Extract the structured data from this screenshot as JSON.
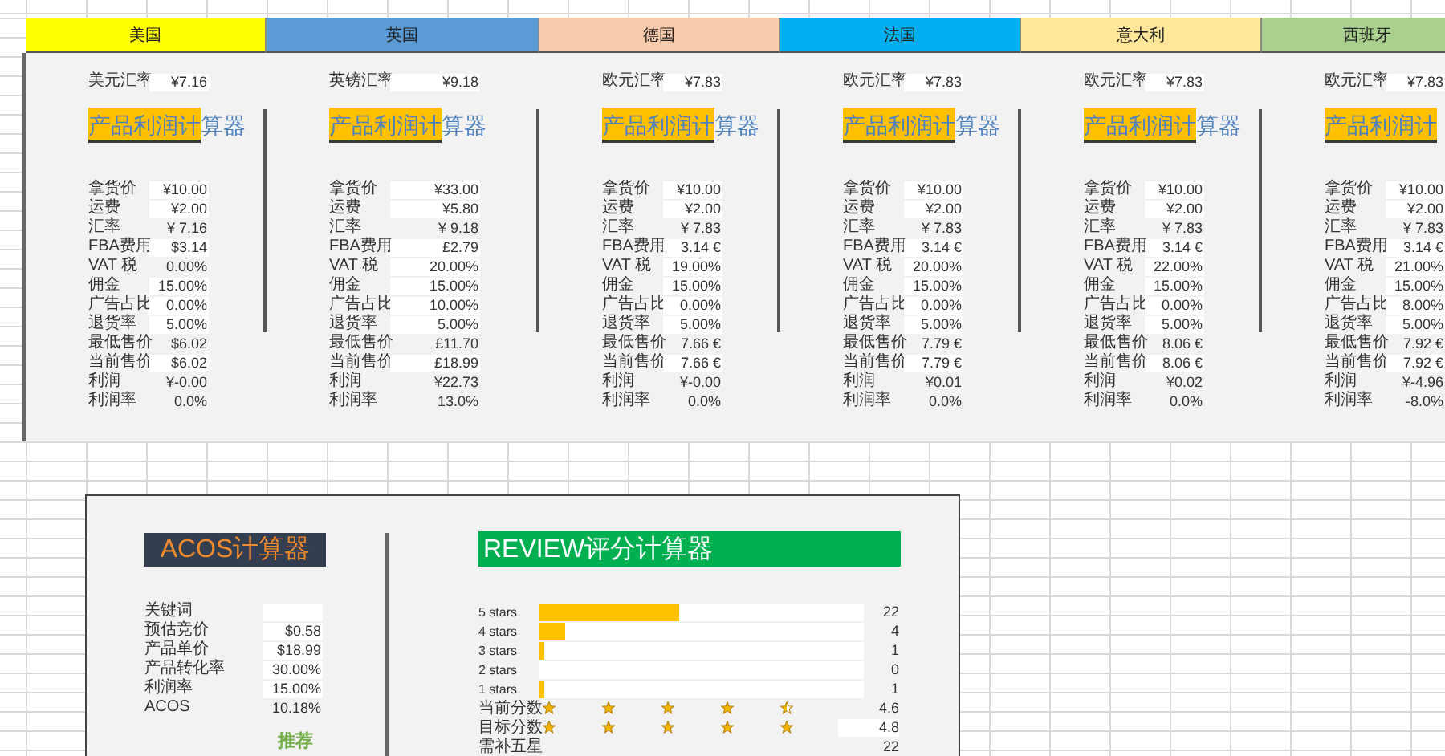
{
  "countries": [
    {
      "name": "美国",
      "color": "#ffff00",
      "rate_label": "美元汇率",
      "rate_value": "¥7.16",
      "title": "产品利润计算器",
      "rows": [
        {
          "label": "拿货价",
          "value": "¥10.00",
          "kind": "input"
        },
        {
          "label": "运费",
          "value": "¥2.00",
          "kind": "input"
        },
        {
          "label": "汇率",
          "value": "¥ 7.16",
          "kind": "plain"
        },
        {
          "label": "FBA费用",
          "value": "$3.14",
          "kind": "input"
        },
        {
          "label": "VAT 税",
          "value": "0.00%",
          "kind": "plain"
        },
        {
          "label": "佣金",
          "value": "15.00%",
          "kind": "input"
        },
        {
          "label": "广告占比",
          "value": "0.00%",
          "kind": "input"
        },
        {
          "label": "退货率",
          "value": "5.00%",
          "kind": "input"
        },
        {
          "label": "最低售价",
          "value": "$6.02",
          "kind": "plain"
        },
        {
          "label": "当前售价",
          "value": "$6.02",
          "kind": "input"
        },
        {
          "label": "利润",
          "value": "¥-0.00",
          "kind": "plain"
        },
        {
          "label": "利润率",
          "value": "0.0%",
          "kind": "plain"
        }
      ]
    },
    {
      "name": "英国",
      "color": "#5b9bd5",
      "rate_label": "英镑汇率",
      "rate_value": "¥9.18",
      "title": "产品利润计算器",
      "rows": [
        {
          "label": "拿货价",
          "value": "¥33.00",
          "kind": "input"
        },
        {
          "label": "运费",
          "value": "¥5.80",
          "kind": "input"
        },
        {
          "label": "汇率",
          "value": "¥ 9.18",
          "kind": "plain"
        },
        {
          "label": "FBA费用",
          "value": "£2.79",
          "kind": "input"
        },
        {
          "label": "VAT 税",
          "value": "20.00%",
          "kind": "input"
        },
        {
          "label": "佣金",
          "value": "15.00%",
          "kind": "input"
        },
        {
          "label": "广告占比",
          "value": "10.00%",
          "kind": "input"
        },
        {
          "label": "退货率",
          "value": "5.00%",
          "kind": "input"
        },
        {
          "label": "最低售价",
          "value": "£11.70",
          "kind": "plain"
        },
        {
          "label": "当前售价",
          "value": "£18.99",
          "kind": "input"
        },
        {
          "label": "利润",
          "value": "¥22.73",
          "kind": "plain"
        },
        {
          "label": "利润率",
          "value": "13.0%",
          "kind": "plain"
        }
      ]
    },
    {
      "name": "德国",
      "color": "#f8cbad",
      "rate_label": "欧元汇率",
      "rate_value": "¥7.83",
      "title": "产品利润计算器",
      "rows": [
        {
          "label": "拿货价",
          "value": "¥10.00",
          "kind": "input"
        },
        {
          "label": "运费",
          "value": "¥2.00",
          "kind": "input"
        },
        {
          "label": "汇率",
          "value": "¥ 7.83",
          "kind": "plain"
        },
        {
          "label": "FBA费用",
          "value": "3.14 €",
          "kind": "input"
        },
        {
          "label": "VAT 税",
          "value": "19.00%",
          "kind": "input"
        },
        {
          "label": "佣金",
          "value": "15.00%",
          "kind": "input"
        },
        {
          "label": "广告占比",
          "value": "0.00%",
          "kind": "input"
        },
        {
          "label": "退货率",
          "value": "5.00%",
          "kind": "input"
        },
        {
          "label": "最低售价",
          "value": "7.66 €",
          "kind": "plain"
        },
        {
          "label": "当前售价",
          "value": "7.66 €",
          "kind": "input"
        },
        {
          "label": "利润",
          "value": "¥-0.00",
          "kind": "plain"
        },
        {
          "label": "利润率",
          "value": "0.0%",
          "kind": "plain"
        }
      ]
    },
    {
      "name": "法国",
      "color": "#00b0f0",
      "rate_label": "欧元汇率",
      "rate_value": "¥7.83",
      "title": "产品利润计算器",
      "rows": [
        {
          "label": "拿货价",
          "value": "¥10.00",
          "kind": "input"
        },
        {
          "label": "运费",
          "value": "¥2.00",
          "kind": "input"
        },
        {
          "label": "汇率",
          "value": "¥ 7.83",
          "kind": "plain"
        },
        {
          "label": "FBA费用",
          "value": "3.14 €",
          "kind": "input"
        },
        {
          "label": "VAT 税",
          "value": "20.00%",
          "kind": "input"
        },
        {
          "label": "佣金",
          "value": "15.00%",
          "kind": "input"
        },
        {
          "label": "广告占比",
          "value": "0.00%",
          "kind": "input"
        },
        {
          "label": "退货率",
          "value": "5.00%",
          "kind": "input"
        },
        {
          "label": "最低售价",
          "value": "7.79 €",
          "kind": "plain"
        },
        {
          "label": "当前售价",
          "value": "7.79 €",
          "kind": "input"
        },
        {
          "label": "利润",
          "value": "¥0.01",
          "kind": "plain"
        },
        {
          "label": "利润率",
          "value": "0.0%",
          "kind": "plain"
        }
      ]
    },
    {
      "name": "意大利",
      "color": "#ffe699",
      "rate_label": "欧元汇率",
      "rate_value": "¥7.83",
      "title": "产品利润计算器",
      "rows": [
        {
          "label": "拿货价",
          "value": "¥10.00",
          "kind": "input"
        },
        {
          "label": "运费",
          "value": "¥2.00",
          "kind": "input"
        },
        {
          "label": "汇率",
          "value": "¥ 7.83",
          "kind": "plain"
        },
        {
          "label": "FBA费用",
          "value": "3.14 €",
          "kind": "input"
        },
        {
          "label": "VAT 税",
          "value": "22.00%",
          "kind": "input"
        },
        {
          "label": "佣金",
          "value": "15.00%",
          "kind": "input"
        },
        {
          "label": "广告占比",
          "value": "0.00%",
          "kind": "input"
        },
        {
          "label": "退货率",
          "value": "5.00%",
          "kind": "input"
        },
        {
          "label": "最低售价",
          "value": "8.06 €",
          "kind": "plain"
        },
        {
          "label": "当前售价",
          "value": "8.06 €",
          "kind": "input"
        },
        {
          "label": "利润",
          "value": "¥0.02",
          "kind": "plain"
        },
        {
          "label": "利润率",
          "value": "0.0%",
          "kind": "plain"
        }
      ]
    },
    {
      "name": "西班牙",
      "color": "#a9d08e",
      "rate_label": "欧元汇率",
      "rate_value": "¥7.83",
      "title": "产品利润计",
      "rows": [
        {
          "label": "拿货价",
          "value": "¥10.00",
          "kind": "input"
        },
        {
          "label": "运费",
          "value": "¥2.00",
          "kind": "input"
        },
        {
          "label": "汇率",
          "value": "¥ 7.83",
          "kind": "plain"
        },
        {
          "label": "FBA费用",
          "value": "3.14 €",
          "kind": "input"
        },
        {
          "label": "VAT 税",
          "value": "21.00%",
          "kind": "input"
        },
        {
          "label": "佣金",
          "value": "15.00%",
          "kind": "input"
        },
        {
          "label": "广告占比",
          "value": "8.00%",
          "kind": "input"
        },
        {
          "label": "退货率",
          "value": "5.00%",
          "kind": "input"
        },
        {
          "label": "最低售价",
          "value": "7.92 €",
          "kind": "plain"
        },
        {
          "label": "当前售价",
          "value": "7.92 €",
          "kind": "input"
        },
        {
          "label": "利润",
          "value": "¥-4.96",
          "kind": "plain"
        },
        {
          "label": "利润率",
          "value": "-8.0%",
          "kind": "plain"
        }
      ]
    }
  ],
  "acos": {
    "title": "ACOS计算器",
    "rows": [
      {
        "label": "关键词",
        "kind": "input"
      },
      {
        "label": "预估竞价",
        "value": "$0.58",
        "kind": "input"
      },
      {
        "label": "产品单价",
        "value": "$18.99",
        "kind": "input"
      },
      {
        "label": "产品转化率",
        "value": "30.00%",
        "kind": "input"
      },
      {
        "label": "利润率",
        "value": "15.00%",
        "kind": "input"
      },
      {
        "label": "ACOS",
        "value": "10.18%",
        "kind": "plain"
      }
    ],
    "recommend": "推荐"
  },
  "review": {
    "title": "REVIEW评分计算器",
    "bars": [
      {
        "label": "5 stars",
        "level": 0.43,
        "count": "22"
      },
      {
        "label": "4 stars",
        "level": 0.08,
        "count": "4"
      },
      {
        "label": "3 stars",
        "level": 0.016,
        "count": "1"
      },
      {
        "label": "2 stars",
        "count": "0"
      },
      {
        "label": "1 stars",
        "level": 0.016,
        "count": "1"
      }
    ],
    "scores": [
      {
        "label": "当前分数",
        "stars": 4.6,
        "value": "4.6",
        "kind": "plain"
      },
      {
        "label": "目标分数",
        "stars": 4.8,
        "value": "4.8",
        "kind": "input"
      }
    ],
    "needed": {
      "label": "需补五星",
      "value": "22"
    }
  }
}
